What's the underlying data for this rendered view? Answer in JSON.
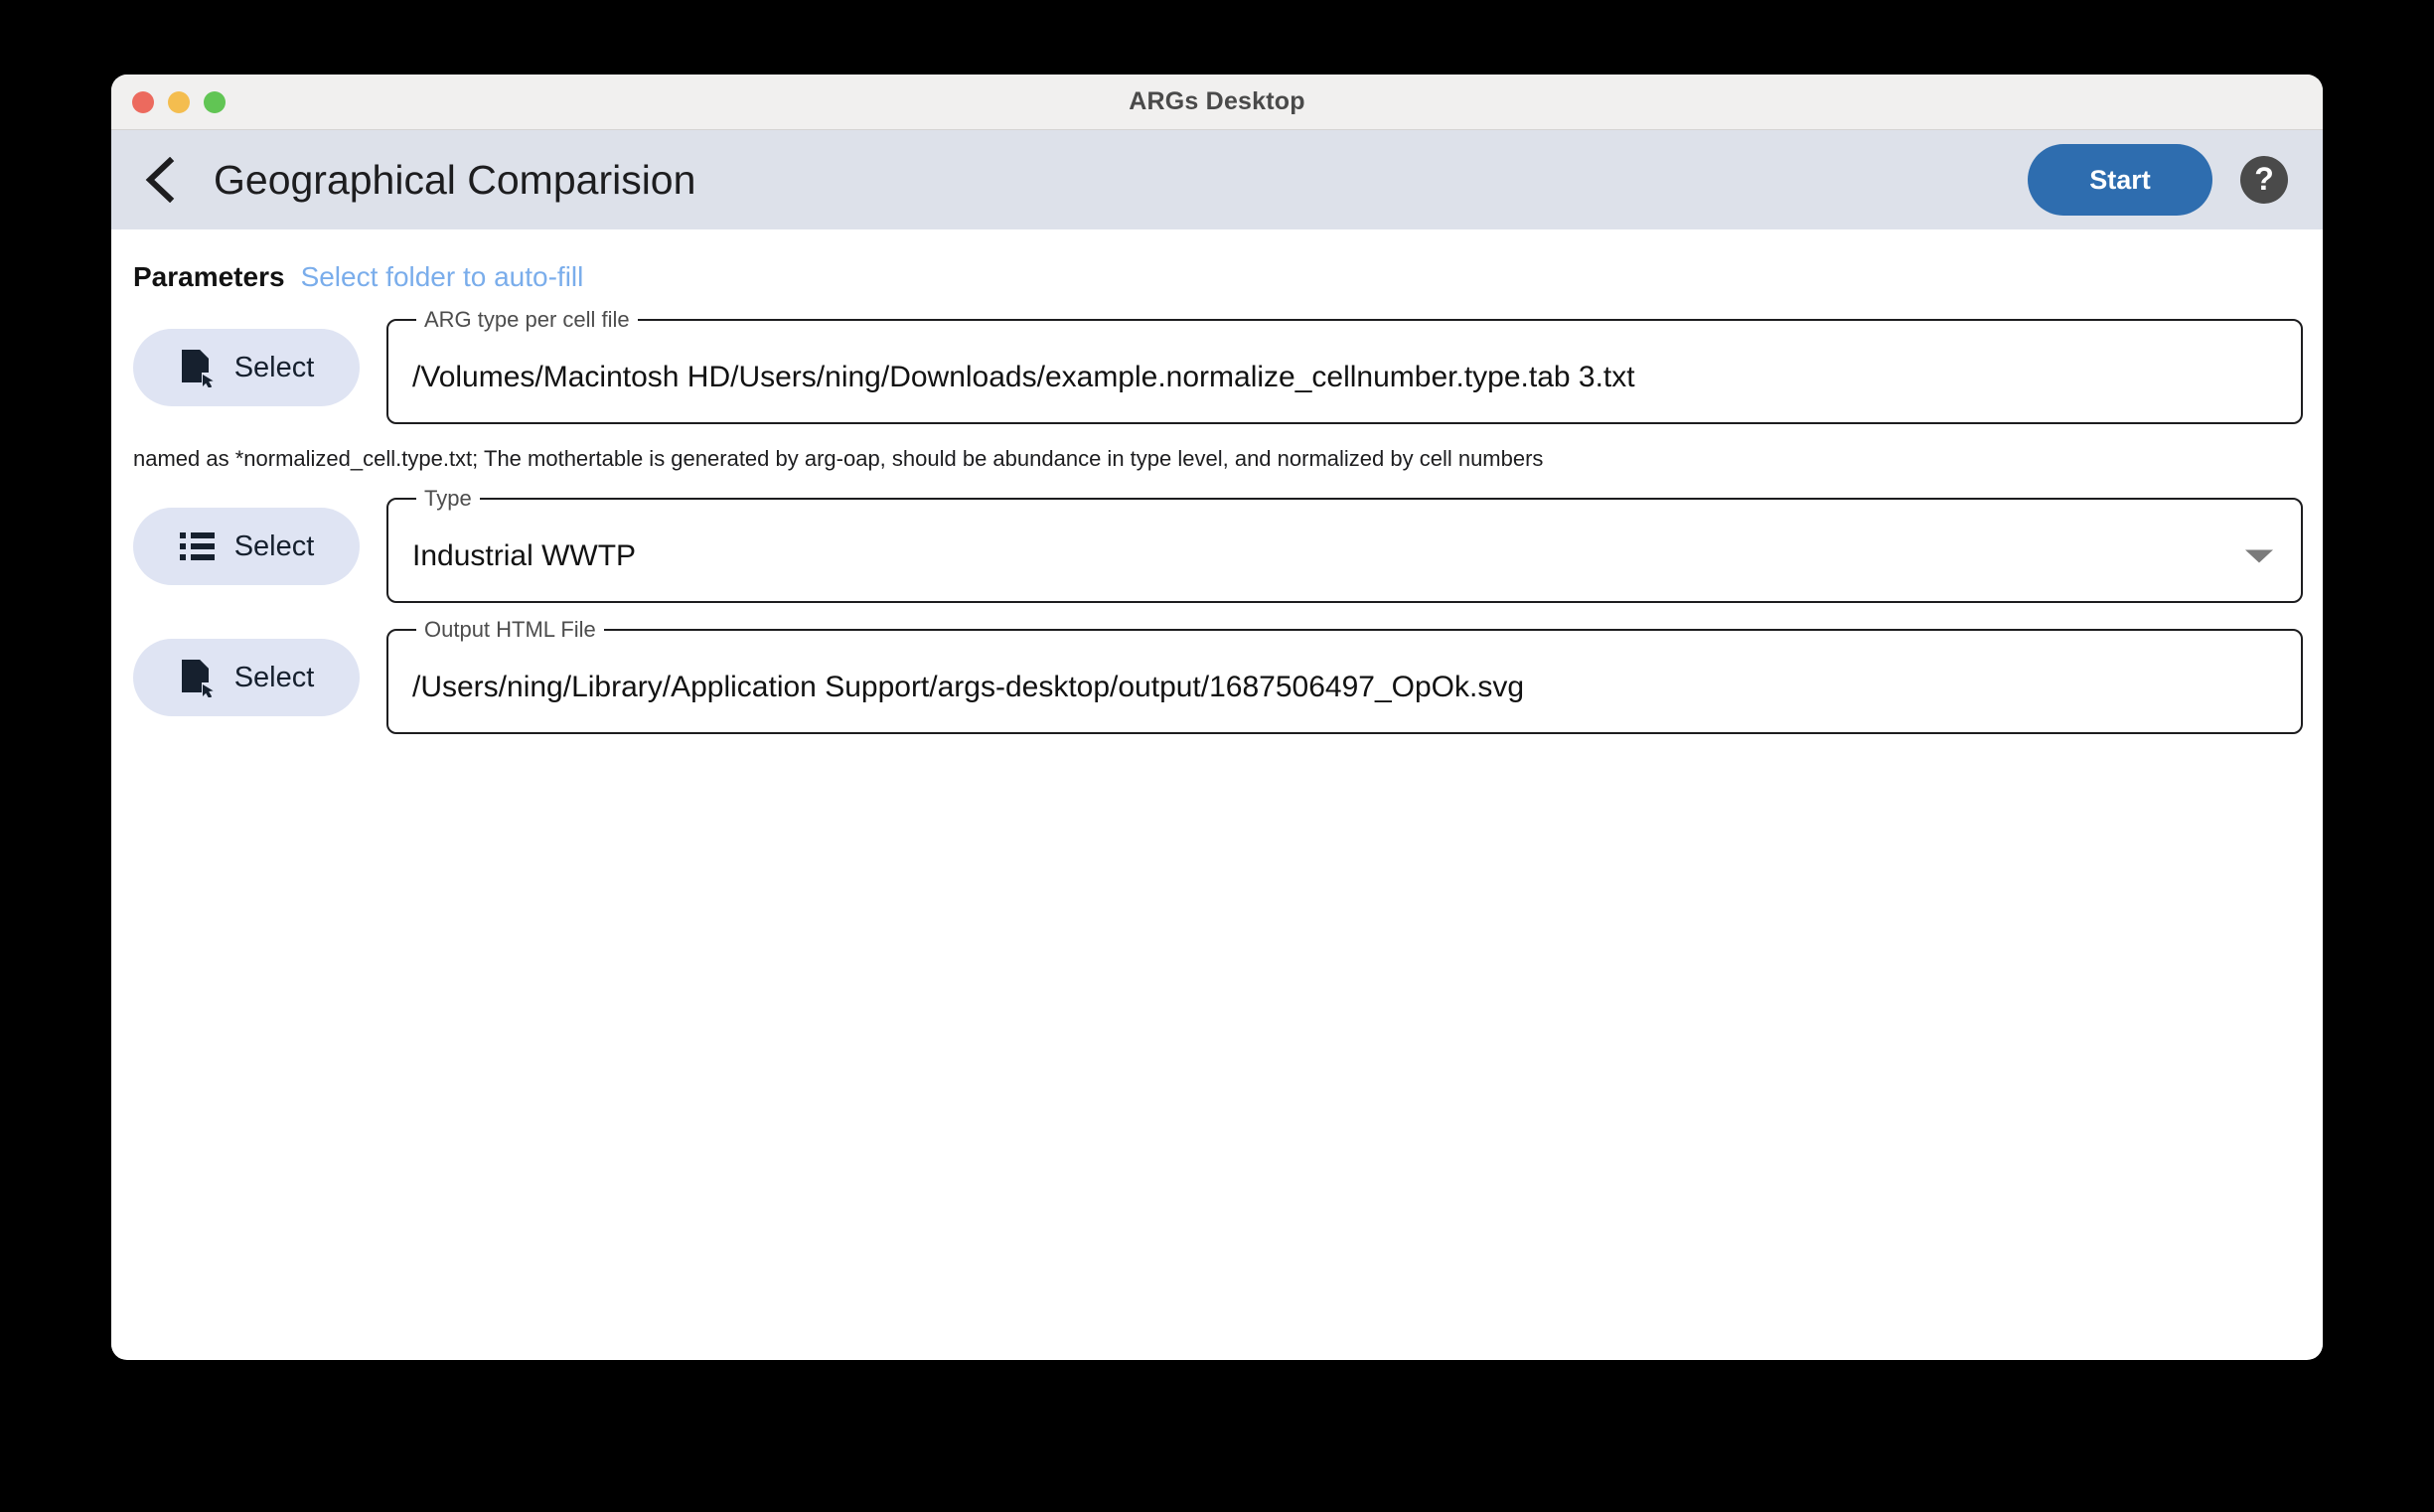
{
  "window": {
    "title": "ARGs Desktop",
    "traffic_lights": [
      {
        "name": "close",
        "color": "#ec6a5e"
      },
      {
        "name": "minimize",
        "color": "#f4bd4f"
      },
      {
        "name": "maximize",
        "color": "#61c554"
      }
    ]
  },
  "header": {
    "back_icon": "chevron-left-icon",
    "page_title": "Geographical Comparision",
    "start_label": "Start",
    "help_label": "?",
    "accent_color": "#2e6daf"
  },
  "parameters": {
    "section_label": "Parameters",
    "autofill_link": "Select folder to auto-fill",
    "autofill_color": "#7aadeb"
  },
  "fields": [
    {
      "legend": "ARG type per cell file",
      "value": "/Volumes/Macintosh HD/Users/ning/Downloads/example.normalize_cellnumber.type.tab 3.txt",
      "placeholder": "",
      "button_label": "Select",
      "button_icon": "file-select-icon",
      "hint": "named as *normalized_cell.type.txt; The mothertable is generated by arg-oap, should be abundance in type level, and normalized by cell numbers"
    },
    {
      "legend": "Type",
      "value": "Industrial WWTP",
      "placeholder": "",
      "button_label": "Select",
      "button_icon": "list-select-icon",
      "caret_icon": "chevron-down-icon",
      "hint": ""
    },
    {
      "legend": "Output HTML File",
      "value": "/Users/ning/Library/Application Support/args-desktop/output/1687506497_OpOk.svg",
      "placeholder": "",
      "button_label": "Select",
      "button_icon": "file-select-icon",
      "hint": ""
    }
  ]
}
